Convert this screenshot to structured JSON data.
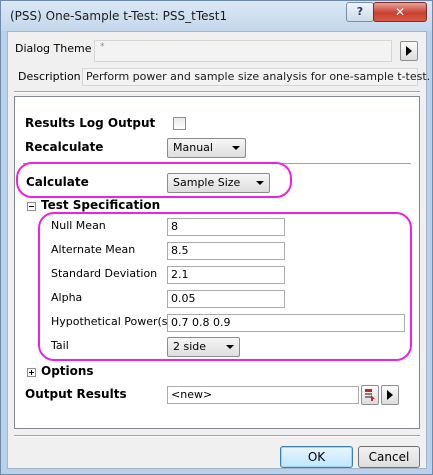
{
  "window": {
    "title": "(PSS) One-Sample t-Test: PSS_tTest1",
    "help_label": "?",
    "close_label": "✕"
  },
  "dialog_theme": {
    "label": "Dialog Theme",
    "value": "*",
    "menu_icon": "right-arrow-icon"
  },
  "description": {
    "label": "Description",
    "value": "Perform power and sample size analysis for one-sample t-test."
  },
  "results_log": {
    "label": "Results Log Output",
    "checked": false
  },
  "recalculate": {
    "label": "Recalculate",
    "value": "Manual"
  },
  "calculate": {
    "label": "Calculate",
    "value": "Sample Size"
  },
  "test_spec": {
    "label": "Test Specification",
    "expanded": true,
    "fields": {
      "null_mean": {
        "label": "Null Mean",
        "value": "8"
      },
      "alternate_mean": {
        "label": "Alternate Mean",
        "value": "8.5"
      },
      "std_dev": {
        "label": "Standard Deviation",
        "value": "2.1"
      },
      "alpha": {
        "label": "Alpha",
        "value": "0.05"
      },
      "hyp_power": {
        "label": "Hypothetical Power(s)",
        "value": "0.7 0.8 0.9"
      },
      "tail": {
        "label": "Tail",
        "value": "2 side"
      }
    }
  },
  "options": {
    "label": "Options",
    "expanded": false
  },
  "output_results": {
    "label": "Output Results",
    "value": "<new>"
  },
  "buttons": {
    "ok": "OK",
    "cancel": "Cancel"
  },
  "colors": {
    "highlight_outline": "#ee22e0",
    "titlebar": "#c3d7ec",
    "close": "#c7402f"
  }
}
